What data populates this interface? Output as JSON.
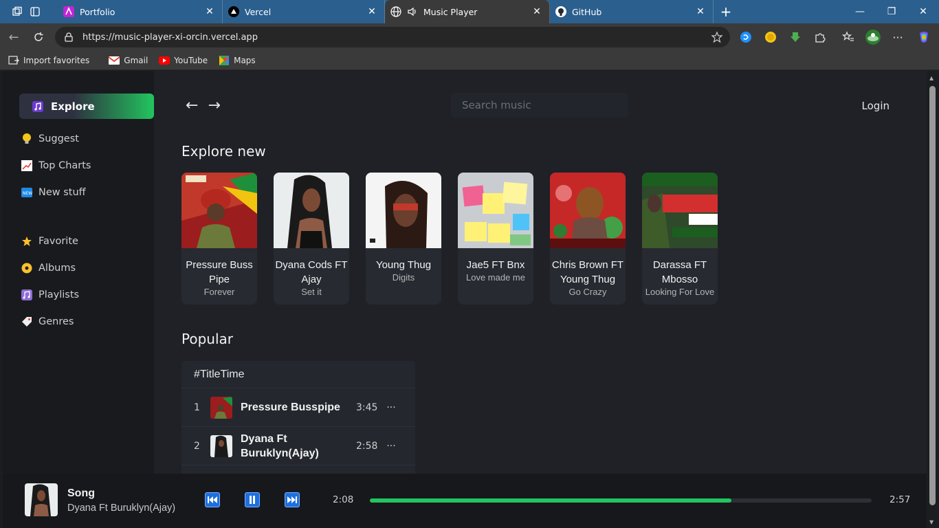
{
  "browser": {
    "tabs": [
      {
        "label": "Portfolio",
        "icon": "portfolio-favicon"
      },
      {
        "label": "Vercel",
        "icon": "vercel-favicon"
      },
      {
        "label": "Music Player",
        "icon": "globe-icon",
        "active": true
      },
      {
        "label": "GitHub",
        "icon": "github-favicon"
      }
    ],
    "url": "https://music-player-xi-orcin.vercel.app",
    "bookmarks": [
      {
        "label": "Import favorites",
        "icon": "import-icon"
      },
      {
        "label": "Gmail",
        "icon": "gmail-icon"
      },
      {
        "label": "YouTube",
        "icon": "youtube-icon"
      },
      {
        "label": "Maps",
        "icon": "maps-icon"
      }
    ]
  },
  "sidebar": {
    "explore_label": "Explore",
    "items": [
      {
        "label": "Suggest",
        "icon": "lightbulb-icon"
      },
      {
        "label": "Top Charts",
        "icon": "chart-icon"
      },
      {
        "label": "New stuff",
        "icon": "new-icon"
      },
      {
        "label": "Favorite",
        "icon": "star-icon"
      },
      {
        "label": "Albums",
        "icon": "disc-icon"
      },
      {
        "label": "Playlists",
        "icon": "music-notes-icon"
      },
      {
        "label": "Genres",
        "icon": "tag-icon"
      }
    ]
  },
  "header": {
    "back": "←",
    "forward": "→",
    "search_placeholder": "Search music",
    "login": "Login"
  },
  "explore": {
    "title": "Explore new",
    "cards": [
      {
        "title": "Pressure Buss Pipe",
        "subtitle": "Forever"
      },
      {
        "title": "Dyana Cods FT Ajay",
        "subtitle": "Set it"
      },
      {
        "title": "Young Thug",
        "subtitle": "Digits"
      },
      {
        "title": "Jae5 FT Bnx",
        "subtitle": "Love made me"
      },
      {
        "title": "Chris Brown FT Young Thug",
        "subtitle": "Go Crazy"
      },
      {
        "title": "Darassa FT Mbosso",
        "subtitle": "Looking For Love"
      }
    ]
  },
  "popular": {
    "title": "Popular",
    "header": "#TitleTime",
    "rows": [
      {
        "num": "1",
        "title": "Pressure Busspipe",
        "time": "3:45",
        "menu": "···"
      },
      {
        "num": "2",
        "title": "Dyana Ft Buruklyn(Ajay)",
        "time": "2:58",
        "menu": "···"
      }
    ]
  },
  "player": {
    "song": "Song",
    "artist": "Dyana Ft Buruklyn(Ajay)",
    "current_time": "2:08",
    "total_time": "2:57",
    "progress": 0.72
  },
  "colors": {
    "accent": "#22c55e",
    "browser_tabbar": "#2b5f8e",
    "control_button": "#1e6fe0"
  }
}
